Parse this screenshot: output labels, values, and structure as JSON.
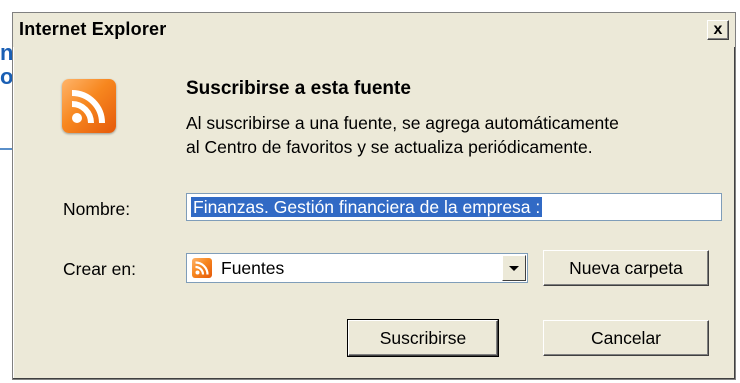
{
  "background_page": {
    "fragment_1": "n",
    "fragment_2": "o"
  },
  "dialog": {
    "title": "Internet Explorer",
    "close_label": "x",
    "heading": "Suscribirse a esta fuente",
    "description_line1": "Al suscribirse a una fuente, se agrega automáticamente",
    "description_line2": "al Centro de favoritos y se actualiza periódicamente.",
    "name_label": "Nombre:",
    "name_value": "Finanzas. Gestión financiera de la empresa :",
    "create_in_label": "Crear en:",
    "folder_selected": "Fuentes",
    "new_folder_button": "Nueva carpeta",
    "subscribe_button": "Suscribirse",
    "cancel_button": "Cancelar"
  },
  "colors": {
    "dialog_bg": "#ece9d8",
    "selection": "#316ac5",
    "rss_orange": "#f7871f"
  },
  "icons": [
    "rss-feed-icon",
    "close-icon",
    "dropdown-arrow-icon"
  ]
}
